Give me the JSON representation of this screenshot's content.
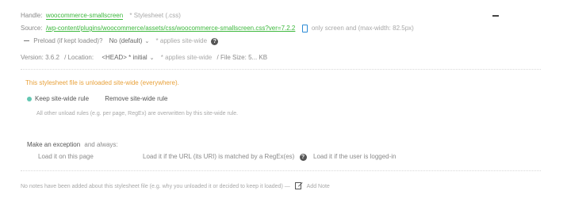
{
  "header": {
    "handle_label": "Handle:",
    "handle_value": "woocommerce-smallscreen",
    "asset_type": "* Stylesheet (.css)"
  },
  "source": {
    "label": "Source:",
    "url": "/wp-content/plugins/woocommerce/assets/css/woocommerce-smallscreen.css?ver=7.2.2",
    "media_text": "only screen and (max-width: 82.5px)"
  },
  "preload": {
    "label": "Preload (if kept loaded)?",
    "value": "No (default)",
    "note": "* applies site-wide"
  },
  "meta": {
    "version": "Version: 3.6.2",
    "location_label": "/ Location:",
    "location_value": "<HEAD> * initial",
    "location_note": "* applies site-wide",
    "file_size": "/ File Size: 5... KB"
  },
  "unload": {
    "heading": "This stylesheet file is unloaded site-wide (everywhere).",
    "option_keep": "Keep site-wide rule",
    "option_remove": "Remove site-wide rule",
    "note": "All other unload rules (e.g. per page, RegEx) are overwritten by this site-wide rule."
  },
  "exception": {
    "label": "Make an exception",
    "label_suffix": "and always:",
    "option_page": "Load it on this page",
    "option_regex": "Load it if the URL (its URI) is matched by a RegEx(es)",
    "option_logged_in": "Load it if the user is logged-in"
  },
  "footer": {
    "note": "No notes have been added about this stylesheet file (e.g. why you unloaded it or decided to keep it loaded) —",
    "add_note": "Add Note"
  },
  "icons": {
    "minimize": "minimize-icon",
    "mobile": "mobile-icon",
    "help": "help-icon",
    "edit_note": "edit-note-icon"
  },
  "colors": {
    "link_green": "#3cb83c",
    "warning_orange": "#e8a13a",
    "radio_teal": "#63c7b2",
    "mobile_blue": "#2b8bd6"
  }
}
